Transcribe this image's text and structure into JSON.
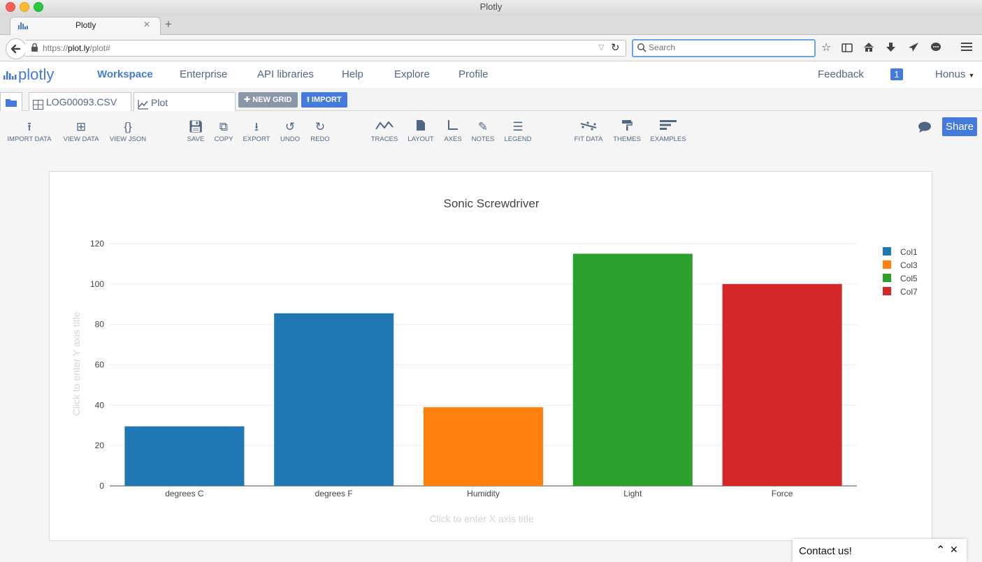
{
  "window": {
    "title": "Plotly"
  },
  "browser": {
    "tab_title": "Plotly",
    "url_prefix": "https://",
    "url_host": "plot.ly",
    "url_path": "/plot#",
    "search_placeholder": "Search",
    "new_tab_label": "+",
    "close_tab_label": "✕"
  },
  "plotly": {
    "logo_text": "plotly",
    "nav": [
      "Workspace",
      "Enterprise",
      "API libraries",
      "Help",
      "Explore",
      "Profile"
    ],
    "feedback": "Feedback",
    "notification_count": "1",
    "user": "Honus"
  },
  "grid_tabs": {
    "file_name": "LOG00093.CSV",
    "plot_tab": "Plot",
    "new_grid": "NEW GRID",
    "import": "IMPORT"
  },
  "toolbar": {
    "import_data": "IMPORT DATA",
    "view_data": "VIEW DATA",
    "view_json": "VIEW JSON",
    "save": "SAVE",
    "copy": "COPY",
    "export": "EXPORT",
    "undo": "UNDO",
    "redo": "REDO",
    "traces": "TRACES",
    "layout": "LAYOUT",
    "axes": "AXES",
    "notes": "NOTES",
    "legend": "LEGEND",
    "fit_data": "FIT DATA",
    "themes": "THEMES",
    "examples": "EXAMPLES",
    "share": "Share"
  },
  "chart_data": {
    "type": "bar",
    "title": "Sonic Screwdriver",
    "xlabel": "Click to enter X axis title",
    "ylabel": "Click to enter Y axis title",
    "categories": [
      "degrees C",
      "degrees F",
      "Humidity",
      "Light",
      "Force"
    ],
    "series": [
      {
        "name": "Col1",
        "color": "#1f77b4",
        "values": [
          29.5,
          85.5,
          null,
          null,
          null
        ]
      },
      {
        "name": "Col3",
        "color": "#ff7f0e",
        "values": [
          null,
          null,
          39,
          null,
          null
        ]
      },
      {
        "name": "Col5",
        "color": "#2ca02c",
        "values": [
          null,
          null,
          null,
          115,
          null
        ]
      },
      {
        "name": "Col7",
        "color": "#d62728",
        "values": [
          null,
          null,
          null,
          null,
          100
        ]
      }
    ],
    "ylim": [
      0,
      120
    ],
    "yticks": [
      0,
      20,
      40,
      60,
      80,
      100,
      120
    ],
    "grid": true,
    "legend_position": "top-right"
  },
  "contact": {
    "label": "Contact us!"
  }
}
